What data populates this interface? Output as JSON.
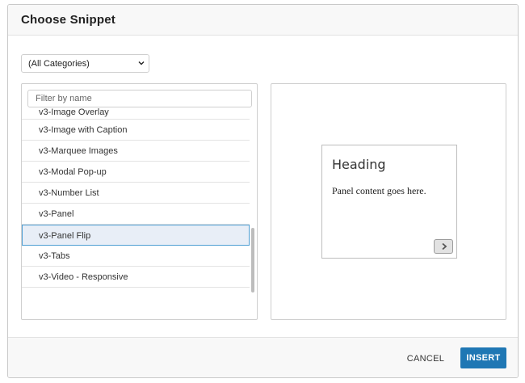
{
  "dialog": {
    "title": "Choose Snippet"
  },
  "category": {
    "selected": "(All Categories)"
  },
  "filter": {
    "placeholder": "Filter by name"
  },
  "snippets": [
    {
      "label": "v3-Image Overlay"
    },
    {
      "label": "v3-Image with Caption"
    },
    {
      "label": "v3-Marquee Images"
    },
    {
      "label": "v3-Modal Pop-up"
    },
    {
      "label": "v3-Number List"
    },
    {
      "label": "v3-Panel"
    },
    {
      "label": "v3-Panel Flip",
      "selected": true
    },
    {
      "label": "v3-Tabs"
    },
    {
      "label": "v3-Video - Responsive"
    }
  ],
  "preview": {
    "heading": "Heading",
    "body": "Panel content goes here.",
    "flip_icon": "chevron-right-icon"
  },
  "footer": {
    "cancel_label": "CANCEL",
    "insert_label": "INSERT"
  },
  "colors": {
    "accent": "#1f77b4",
    "selection_bg": "#e8eef7",
    "selection_border": "#4f9fd3"
  }
}
